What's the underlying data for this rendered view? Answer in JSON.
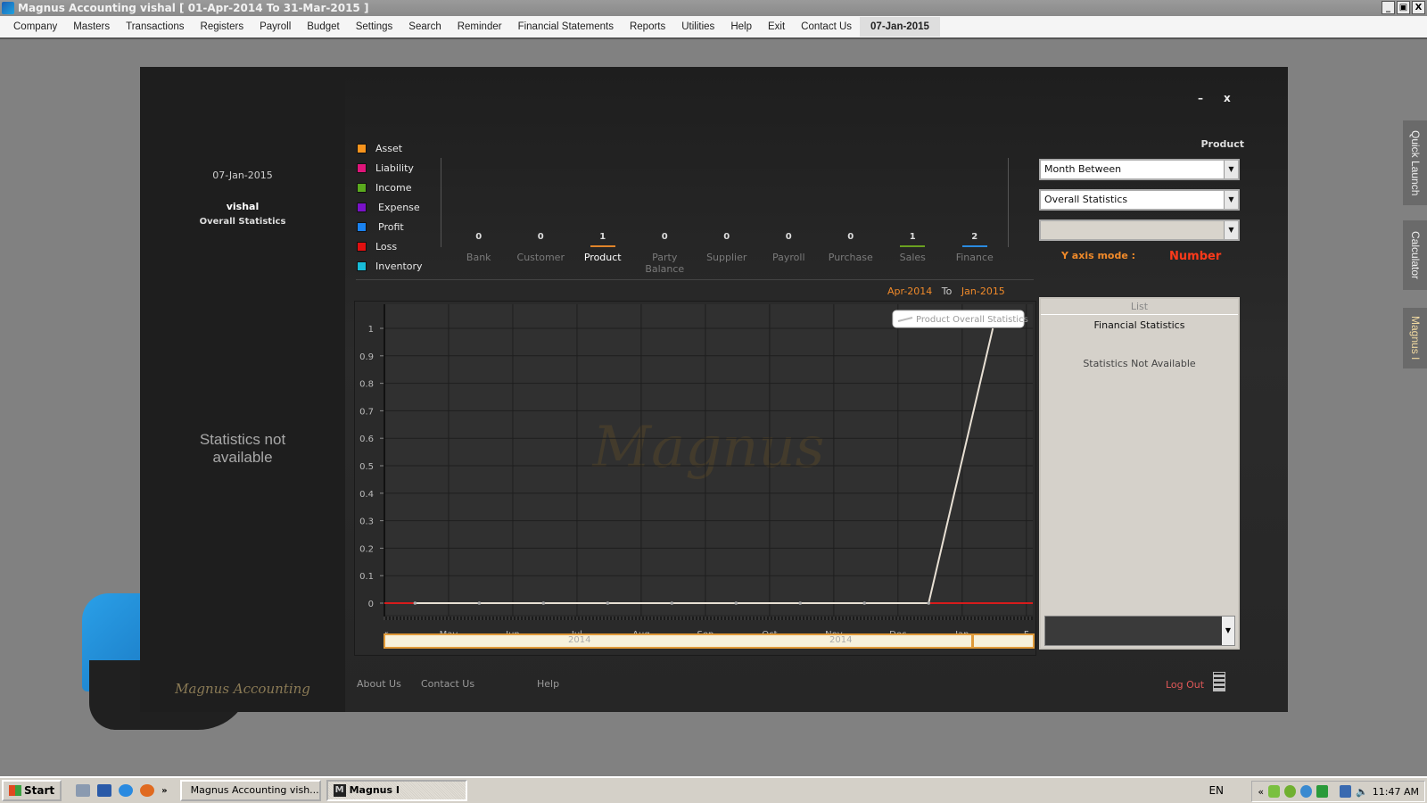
{
  "window": {
    "title": "Magnus Accounting vishal [ 01-Apr-2014 To 31-Mar-2015 ]",
    "controls": [
      "_",
      " ",
      "X"
    ]
  },
  "menu": [
    "Company",
    "Masters",
    "Transactions",
    "Registers",
    "Payroll",
    "Budget",
    "Settings",
    "Search",
    "Reminder",
    "Financial Statements",
    "Reports",
    "Utilities",
    "Help",
    "Exit",
    "Contact Us"
  ],
  "menu_date": "07-Jan-2015",
  "dialog": {
    "minimize": "–",
    "close": "x"
  },
  "left": {
    "date": "07-Jan-2015",
    "user": "vishal",
    "subtitle": "Overall Statistics",
    "empty_text": "Statistics not available",
    "brand": "Magnus Accounting"
  },
  "legend": [
    {
      "label": "Asset",
      "color": "#f7941d"
    },
    {
      "label": "Liability",
      "color": "#e0157a"
    },
    {
      "label": "Income",
      "color": "#5aaa1e"
    },
    {
      "label": "Expense",
      "color": "#7a12c8"
    },
    {
      "label": "Profit",
      "color": "#1a82f0"
    },
    {
      "label": "Loss",
      "color": "#e01010"
    },
    {
      "label": "Inventory",
      "color": "#18bcd8"
    }
  ],
  "categories": [
    {
      "label": "Bank",
      "count": "0",
      "underline": ""
    },
    {
      "label": "Customer",
      "count": "0",
      "underline": ""
    },
    {
      "label": "Product",
      "count": "1",
      "underline": "#e0842a",
      "active": true
    },
    {
      "label": "Party Balance",
      "count": "0",
      "underline": ""
    },
    {
      "label": "Supplier",
      "count": "0",
      "underline": ""
    },
    {
      "label": "Payroll",
      "count": "0",
      "underline": ""
    },
    {
      "label": "Purchase",
      "count": "0",
      "underline": ""
    },
    {
      "label": "Sales",
      "count": "1",
      "underline": "#6aa020"
    },
    {
      "label": "Finance",
      "count": "2",
      "underline": "#2a8ae0"
    }
  ],
  "range": {
    "from": "Apr-2014",
    "to_label": "To",
    "to": "Jan-2015"
  },
  "chart_data": {
    "type": "line",
    "title": "",
    "watermark": "Magnus",
    "legend": "top-right",
    "legend_label": "Product Overall Statistics",
    "x": [
      "Apr",
      "May",
      "Jun",
      "Jul",
      "Aug",
      "Sep",
      "Oct",
      "Nov",
      "Dec",
      "Jan",
      "Feb"
    ],
    "x_tick_labels": [
      "r",
      "May",
      "Jun",
      "Jul",
      "Aug",
      "Sep",
      "Oct",
      "Nov",
      "Dec",
      "Jan",
      "F"
    ],
    "series": [
      {
        "name": "Product Overall Statistics",
        "points": [
          [
            0.45,
            0
          ],
          [
            1.45,
            0
          ],
          [
            2.45,
            0
          ],
          [
            3.45,
            0
          ],
          [
            4.45,
            0
          ],
          [
            5.45,
            0
          ],
          [
            6.45,
            0
          ],
          [
            7.45,
            0
          ],
          [
            8.45,
            0
          ],
          [
            9.45,
            1
          ]
        ]
      }
    ],
    "baseline_color": "#d81c1c",
    "ylim": [
      0,
      1
    ],
    "y_ticks": [
      "0",
      "0.1",
      "0.2",
      "0.3",
      "0.4",
      "0.5",
      "0.6",
      "0.7",
      "0.8",
      "0.9",
      "1"
    ],
    "grid": true,
    "year_labels": [
      "2014",
      "2014"
    ]
  },
  "right": {
    "title": "Product",
    "combo1": "Month Between",
    "combo2": "Overall Statistics",
    "combo3": "",
    "yaxis_label": "Y axis mode :",
    "yaxis_value": "Number",
    "list_tab": "List",
    "list_title": "Financial Statistics",
    "list_empty": "Statistics Not Available"
  },
  "footer": {
    "about": "About Us",
    "contact": "Contact Us",
    "help": "Help",
    "logout": "Log Out"
  },
  "sidetabs": [
    "Quick Launch",
    "Calculator",
    "Magnus I"
  ],
  "taskbar": {
    "start": "Start",
    "tasks": [
      "Magnus Accounting vish...",
      "Magnus I"
    ],
    "lang": "EN",
    "time": "11:47 AM"
  }
}
